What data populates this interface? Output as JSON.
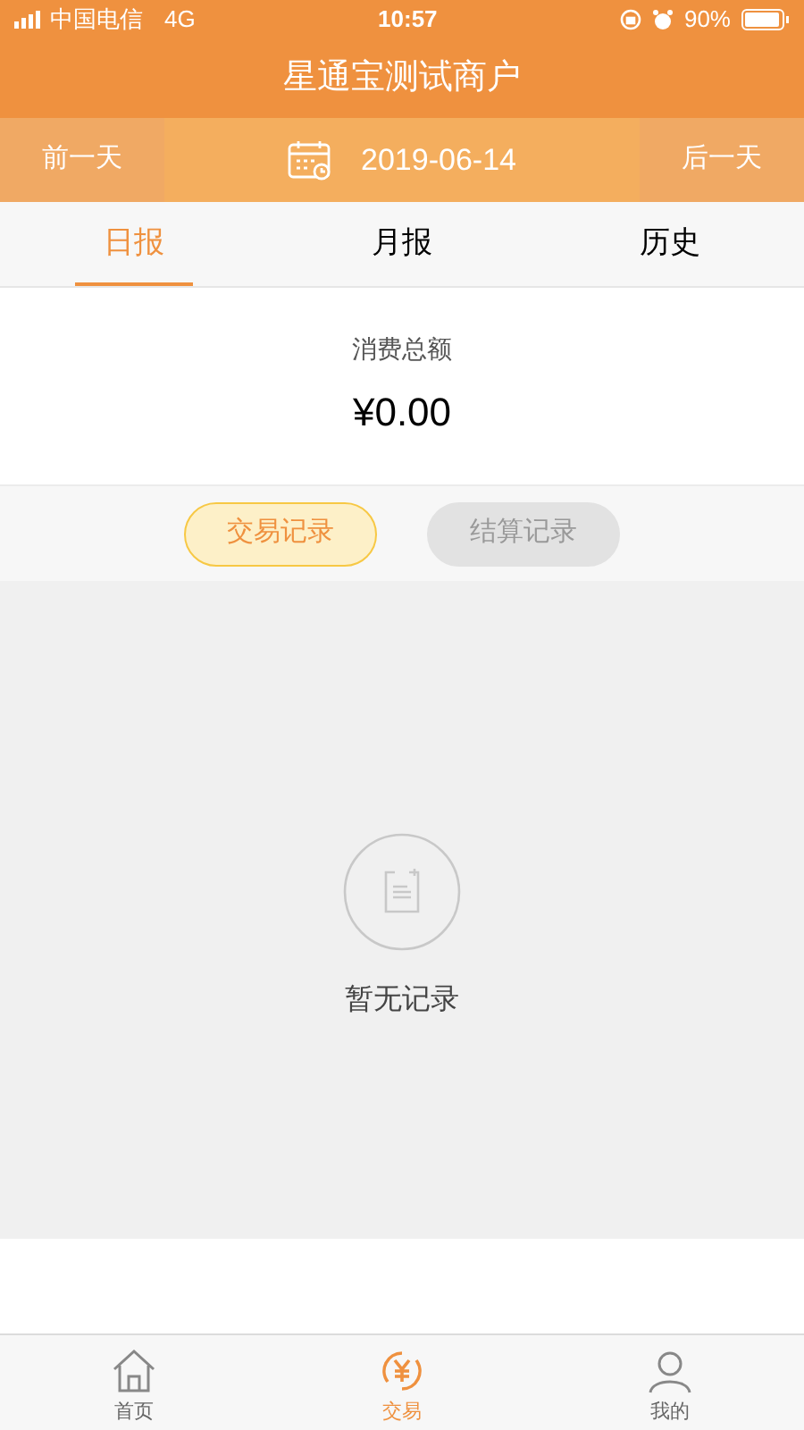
{
  "status_bar": {
    "carrier": "中国电信",
    "network": "4G",
    "time": "10:57",
    "battery": "90%"
  },
  "title": "星通宝测试商户",
  "date_nav": {
    "prev": "前一天",
    "date": "2019-06-14",
    "next": "后一天"
  },
  "tabs": [
    {
      "label": "日报",
      "selected": true
    },
    {
      "label": "月报",
      "selected": false
    },
    {
      "label": "历史",
      "selected": false
    }
  ],
  "summary": {
    "label": "消费总额",
    "amount": "¥0.00"
  },
  "record_tabs": [
    {
      "label": "交易记录",
      "selected": true
    },
    {
      "label": "结算记录",
      "selected": false
    }
  ],
  "empty_state": {
    "text": "暂无记录"
  },
  "bottom_nav": [
    {
      "label": "首页",
      "selected": false
    },
    {
      "label": "交易",
      "selected": true
    },
    {
      "label": "我的",
      "selected": false
    }
  ]
}
